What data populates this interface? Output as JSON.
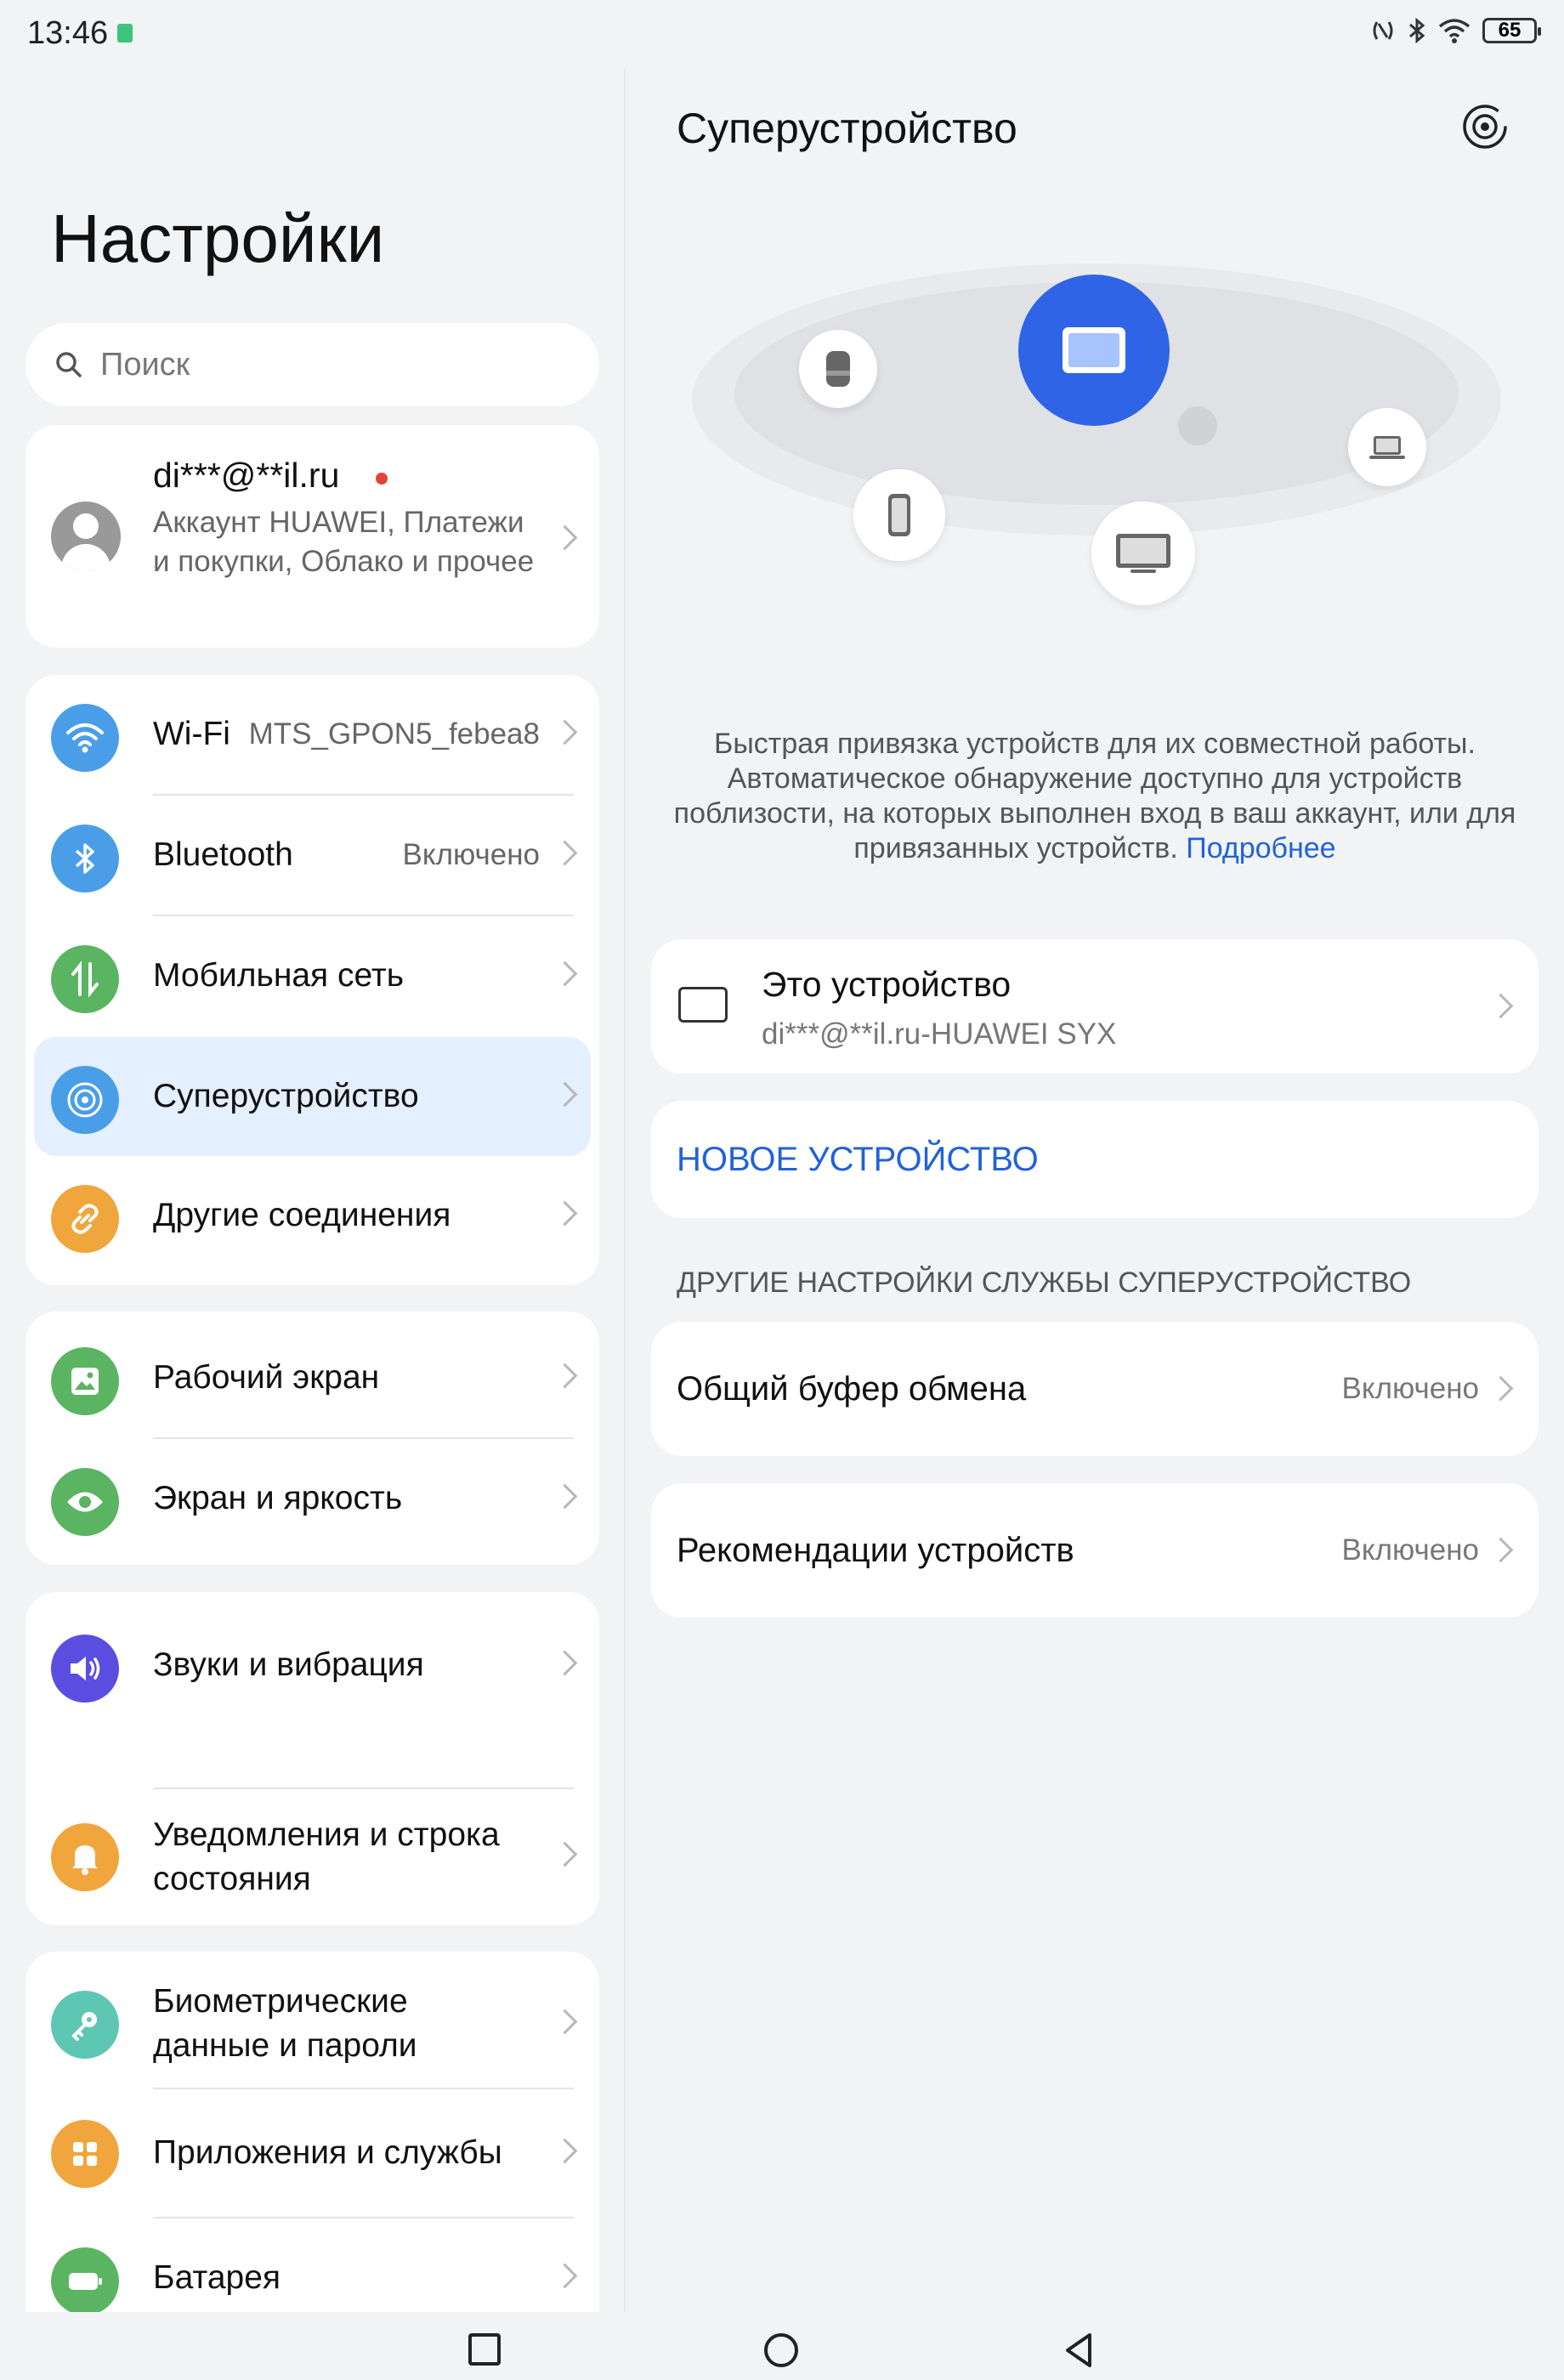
{
  "status_bar": {
    "time": "13:46",
    "battery": "65"
  },
  "left": {
    "title": "Настройки",
    "search_placeholder": "Поиск",
    "account": {
      "email": "di***@**il.ru",
      "description": "Аккаунт HUAWEI, Платежи и покупки, Облако и прочее"
    },
    "group1": [
      {
        "label": "Wi-Fi",
        "value": "MTS_GPON5_febea8",
        "icon": "wifi-icon",
        "color": "#4a9ee8"
      },
      {
        "label": "Bluetooth",
        "value": "Включено",
        "icon": "bluetooth-icon",
        "color": "#4a9ee8"
      },
      {
        "label": "Мобильная сеть",
        "value": "",
        "icon": "mobile-network-icon",
        "color": "#5bb462"
      },
      {
        "label": "Суперустройство",
        "value": "",
        "icon": "superdevice-icon",
        "color": "#4a9ee8",
        "selected": true
      },
      {
        "label": "Другие соединения",
        "value": "",
        "icon": "link-icon",
        "color": "#f0a63c"
      }
    ],
    "group2": [
      {
        "label": "Рабочий экран",
        "icon": "home-screen-icon",
        "color": "#5bb462"
      },
      {
        "label": "Экран и яркость",
        "icon": "eye-icon",
        "color": "#5bb462"
      }
    ],
    "group3": [
      {
        "label": "Звуки и вибрация",
        "icon": "sound-icon",
        "color": "#5a4ee0"
      },
      {
        "label": "Уведомления и строка состояния",
        "icon": "bell-icon",
        "color": "#f0a63c"
      }
    ],
    "group4": [
      {
        "label": "Биометрические данные и пароли",
        "icon": "key-icon",
        "color": "#5ec7b4"
      },
      {
        "label": "Приложения и службы",
        "icon": "apps-icon",
        "color": "#f0a63c"
      },
      {
        "label": "Батарея",
        "icon": "battery-icon",
        "color": "#5bb462"
      }
    ]
  },
  "right": {
    "title": "Суперустройство",
    "description": "Быстрая привязка устройств для их совместной работы. Автоматическое обнаружение доступно для устройств поблизости, на которых выполнен вход в ваш аккаунт, или для привязанных устройств.",
    "more_link": "Подробнее",
    "this_device": {
      "title": "Это устройство",
      "subtitle": "di***@**il.ru-HUAWEI SYX"
    },
    "new_device": "НОВОЕ УСТРОЙСТВО",
    "section_header": "ДРУГИЕ НАСТРОЙКИ СЛУЖБЫ СУПЕРУСТРОЙСТВО",
    "settings": [
      {
        "label": "Общий буфер обмена",
        "value": "Включено"
      },
      {
        "label": "Рекомендации устройств",
        "value": "Включено"
      }
    ]
  }
}
